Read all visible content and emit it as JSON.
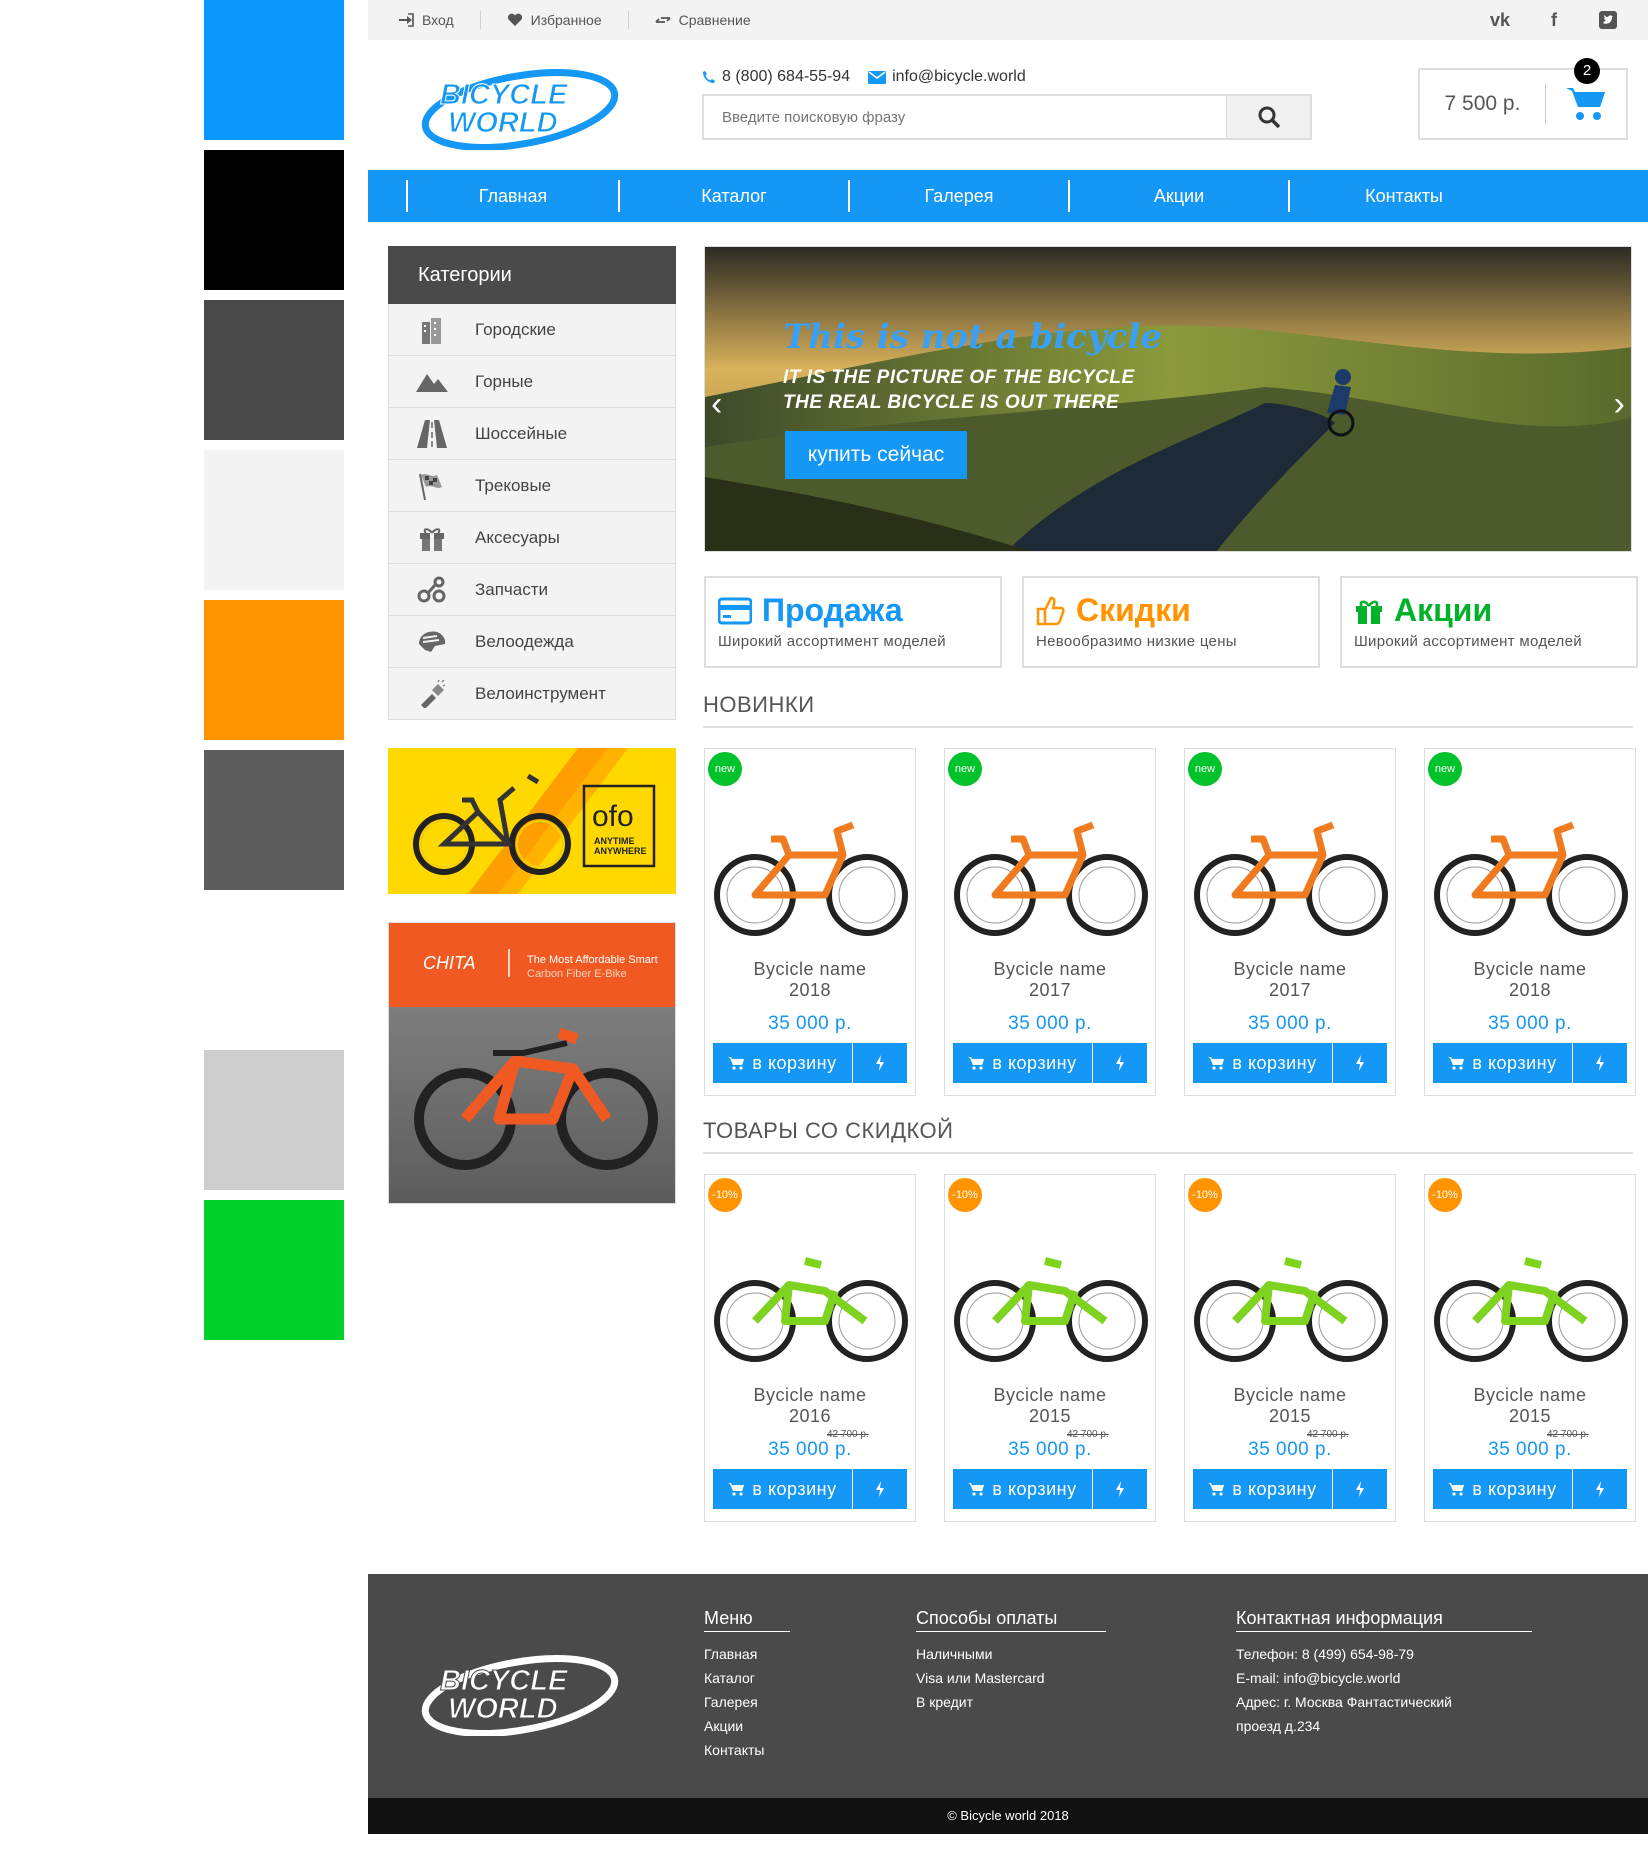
{
  "palette": [
    "#0a97fb",
    "#000000",
    "#4a4a4a",
    "#f3f3f3",
    "#ff9400",
    "#5d5d5d",
    "#cdcdcd",
    "#00d02a"
  ],
  "topbar": {
    "login": "Вход",
    "favorites": "Избранное",
    "compare": "Сравнение",
    "social": [
      "vk-icon",
      "facebook-icon",
      "twitter-icon"
    ]
  },
  "header": {
    "logo_line1": "BICYCLE",
    "logo_line2": "WORLD",
    "phone": "8 (800) 684-55-94",
    "email": "info@bicycle.world",
    "search_placeholder": "Введите поисковую фразу",
    "cart_sum": "7 500 р.",
    "cart_count": "2"
  },
  "nav": [
    "Главная",
    "Каталог",
    "Галерея",
    "Акции",
    "Контакты"
  ],
  "sidebar": {
    "title": "Категории",
    "items": [
      {
        "label": "Городские",
        "icon": "city-icon"
      },
      {
        "label": "Горные",
        "icon": "mountain-icon"
      },
      {
        "label": "Шоссейные",
        "icon": "road-icon"
      },
      {
        "label": "Трековые",
        "icon": "flag-icon"
      },
      {
        "label": "Аксесуары",
        "icon": "gift-icon"
      },
      {
        "label": "Запчасти",
        "icon": "chain-icon"
      },
      {
        "label": "Велоодежда",
        "icon": "helmet-icon"
      },
      {
        "label": "Велоинструмент",
        "icon": "flashlight-icon"
      }
    ],
    "banner1": {
      "brand": "ofo",
      "tagline1": "ANYTIME",
      "tagline2": "ANYWHERE"
    },
    "banner2": {
      "brand": "CHITA",
      "line1": "The Most Affordable Smart",
      "line2": "Carbon Fiber E-Bike"
    }
  },
  "slider": {
    "title": "This is not a bicycle",
    "line1": "IT IS THE PICTURE OF THE BICYCLE",
    "line2": "THE REAL BICYCLE IS OUT THERE",
    "button": "купить сейчас"
  },
  "features": [
    {
      "title": "Продажа",
      "subtitle": "Широкий ассортимент моделей",
      "color": "#1497f5",
      "icon": "card-icon"
    },
    {
      "title": "Скидки",
      "subtitle": "Невообразимо низкие цены",
      "color": "#ff9400",
      "icon": "thumbs-up-icon"
    },
    {
      "title": "Акции",
      "subtitle": "Широкий ассортимент моделей",
      "color": "#00b22a",
      "icon": "gift-icon"
    }
  ],
  "new_section": {
    "title": "НОВИНКИ",
    "badge": "new",
    "products": [
      {
        "name": "Bycicle name",
        "year": "2018",
        "price": "35 000 р."
      },
      {
        "name": "Bycicle name",
        "year": "2017",
        "price": "35 000 р."
      },
      {
        "name": "Bycicle name",
        "year": "2017",
        "price": "35 000 р."
      },
      {
        "name": "Bycicle name",
        "year": "2018",
        "price": "35 000 р."
      }
    ]
  },
  "sale_section": {
    "title": "ТОВАРЫ СО СКИДКОЙ",
    "badge": "-10%",
    "products": [
      {
        "name": "Bycicle name",
        "year": "2016",
        "old_price": "42 700 р.",
        "price": "35 000 р."
      },
      {
        "name": "Bycicle name",
        "year": "2015",
        "old_price": "42 700 р.",
        "price": "35 000 р."
      },
      {
        "name": "Bycicle name",
        "year": "2015",
        "old_price": "42 700 р.",
        "price": "35 000 р."
      },
      {
        "name": "Bycicle name",
        "year": "2015",
        "old_price": "42 700 р.",
        "price": "35 000 р."
      }
    ]
  },
  "buy_label": "в корзину",
  "footer": {
    "menu_title": "Меню",
    "menu": [
      "Главная",
      "Каталог",
      "Галерея",
      "Акции",
      "Контакты"
    ],
    "pay_title": "Способы оплаты",
    "pay": [
      "Наличными",
      "Visa или Mastercard",
      "В кредит"
    ],
    "contact_title": "Контактная информация",
    "contact": [
      "Телефон: 8 (499) 654-98-79",
      "E-mail: info@bicycle.world",
      "Адрес: г. Москва Фантастический",
      "проезд д.234"
    ],
    "copyright": "© Bicycle world 2018"
  }
}
